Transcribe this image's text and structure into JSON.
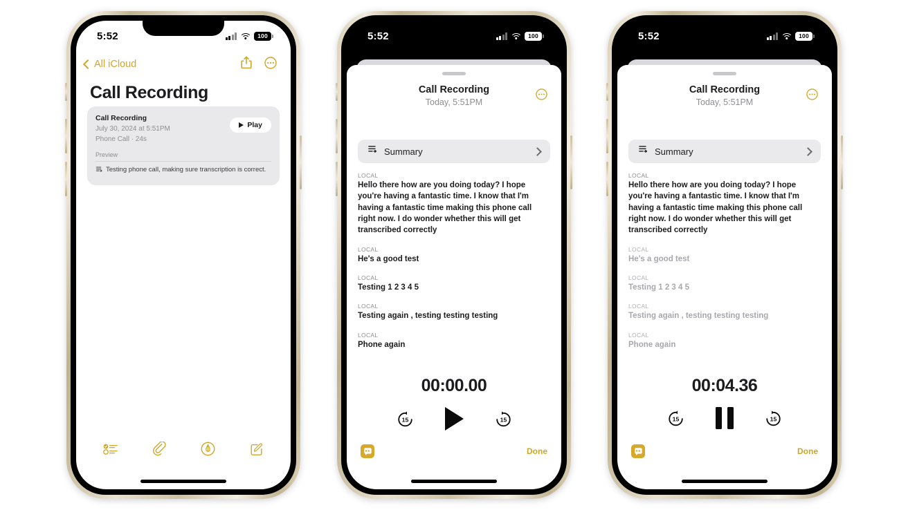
{
  "accent_gold": "#cfa726",
  "status_bar": {
    "time": "5:52",
    "battery_level": "100",
    "icons": [
      "cellular-icon",
      "wifi-icon",
      "battery-icon"
    ]
  },
  "phone1": {
    "nav": {
      "back_label": "All iCloud",
      "share_icon": "share-icon",
      "more_icon": "more-circle-icon"
    },
    "page_title": "Call Recording",
    "recording_card": {
      "title": "Call Recording",
      "date": "July 30, 2024 at 5:51PM",
      "meta": "Phone Call · 24s",
      "play_label": "Play",
      "preview_label": "Preview",
      "preview_icon": "transcript-icon",
      "preview_text": "Testing phone call, making sure transcription is correct."
    },
    "tabbar": [
      {
        "name": "checklist-icon"
      },
      {
        "name": "paperclip-icon"
      },
      {
        "name": "markup-pen-icon"
      },
      {
        "name": "compose-icon"
      }
    ]
  },
  "phone2": {
    "sheet_title": "Call Recording",
    "sheet_date": "Today, 5:51PM",
    "more_icon": "more-circle-icon",
    "summary": {
      "label": "Summary",
      "icon": "transcript-icon",
      "chevron": "chevron-right-icon"
    },
    "transcript": [
      {
        "speaker": "LOCAL",
        "text": "Hello there how are you doing today? I hope you're having a fantastic time. I know that I'm having a fantastic time making this phone call right now. I do wonder whether this will get transcribed correctly",
        "dim": false
      },
      {
        "speaker": "LOCAL",
        "text": "He's a good test",
        "dim": false
      },
      {
        "speaker": "LOCAL",
        "text": "Testing 1 2 3 4 5",
        "dim": false
      },
      {
        "speaker": "LOCAL",
        "text": "Testing again , testing testing testing",
        "dim": false
      },
      {
        "speaker": "LOCAL",
        "text": "Phone again",
        "dim": false
      }
    ],
    "timecode": "00:00.00",
    "controls": {
      "skip_back_label": "15",
      "skip_forward_label": "15",
      "main": "play-button"
    },
    "bottom": {
      "transcript_toggle_icon": "transcript-bubble-icon",
      "done_label": "Done"
    }
  },
  "phone3": {
    "sheet_title": "Call Recording",
    "sheet_date": "Today, 5:51PM",
    "more_icon": "more-circle-icon",
    "summary": {
      "label": "Summary",
      "icon": "transcript-icon",
      "chevron": "chevron-right-icon"
    },
    "transcript": [
      {
        "speaker": "LOCAL",
        "text": "Hello there how are you doing today? I hope you're having a fantastic time. I know that I'm having a fantastic time making this phone call right now. I do wonder whether this will get transcribed correctly",
        "dim": false
      },
      {
        "speaker": "LOCAL",
        "text": "He's a good test",
        "dim": true
      },
      {
        "speaker": "LOCAL",
        "text": "Testing 1 2 3 4 5",
        "dim": true
      },
      {
        "speaker": "LOCAL",
        "text": "Testing again , testing testing testing",
        "dim": true
      },
      {
        "speaker": "LOCAL",
        "text": "Phone again",
        "dim": true
      }
    ],
    "timecode": "00:04.36",
    "controls": {
      "skip_back_label": "15",
      "skip_forward_label": "15",
      "main": "pause-button"
    },
    "bottom": {
      "transcript_toggle_icon": "transcript-bubble-icon",
      "done_label": "Done"
    }
  }
}
